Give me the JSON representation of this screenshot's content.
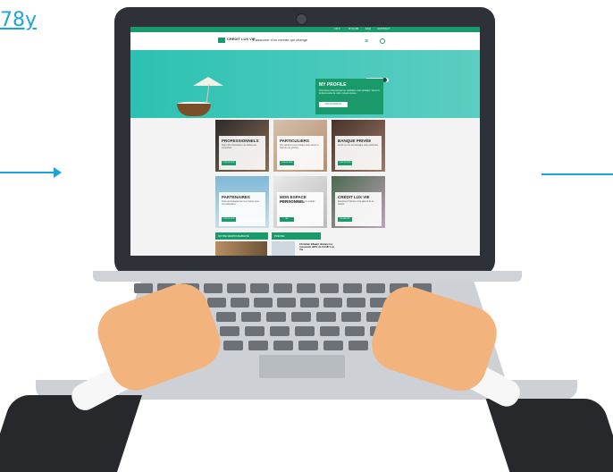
{
  "link_fragment": "78y",
  "colors": {
    "accent": "#1a9a6a",
    "arrow": "#1aa6d9",
    "hero": "#3fc7b9",
    "laptop_bezel": "#2e3137"
  },
  "site": {
    "topbar_links": [
      "FR ▾",
      "B.CLUB",
      "FAQ",
      "CONTACT"
    ],
    "logo": "CRÉDIT LUX VIE",
    "tagline": "L'assureur d'un monde qui change",
    "menu_icon": "menu-icon",
    "search_icon": "search-icon",
    "hero": {
      "profile_title": "MY PROFILE",
      "profile_text": "Vous êtes professionnel ou souhaitez vous protéger. Venez à la découverte de notre nouvel espace.",
      "profile_button": "DÉCOUVRIR ET COMMENCER"
    },
    "cards": [
      {
        "title": "PROFESSIONNELS",
        "text": "Notre offre d'assurance vie dédiée aux entreprises",
        "button": "VOIR LE SITE"
      },
      {
        "title": "PARTICULIERS",
        "text": "Nos solutions pour protéger votre avenir et celui de vos proches",
        "button": "VOIR LE SITE"
      },
      {
        "title": "BANQUE PRIVÉE",
        "text": "Crédit Lux Vie accompagne votre patrimoine",
        "button": "VOIR LE SITE"
      },
      {
        "title": "PARTENAIRES",
        "text": "Notre accompagnement sur mesure pour nos partenaires",
        "button": "VOIR LE SITE"
      },
      {
        "title": "MON ESPACE PERSONNEL",
        "text": "Consultez vos données et vos contrats",
        "button": "ME CONNECTER"
      },
      {
        "title": "CRÉDIT LUX VIE",
        "text": "Découvrez l'histoire et les valeurs de la société",
        "button": "EN SAVOIR PLUS"
      }
    ],
    "bottom_tabs": [
      "NOTRE RESPONSABILITÉ",
      "PRESSE"
    ],
    "news_headline": "Christian Ellwart déclare les nouveaux défis de Crédit Lux Vie"
  }
}
